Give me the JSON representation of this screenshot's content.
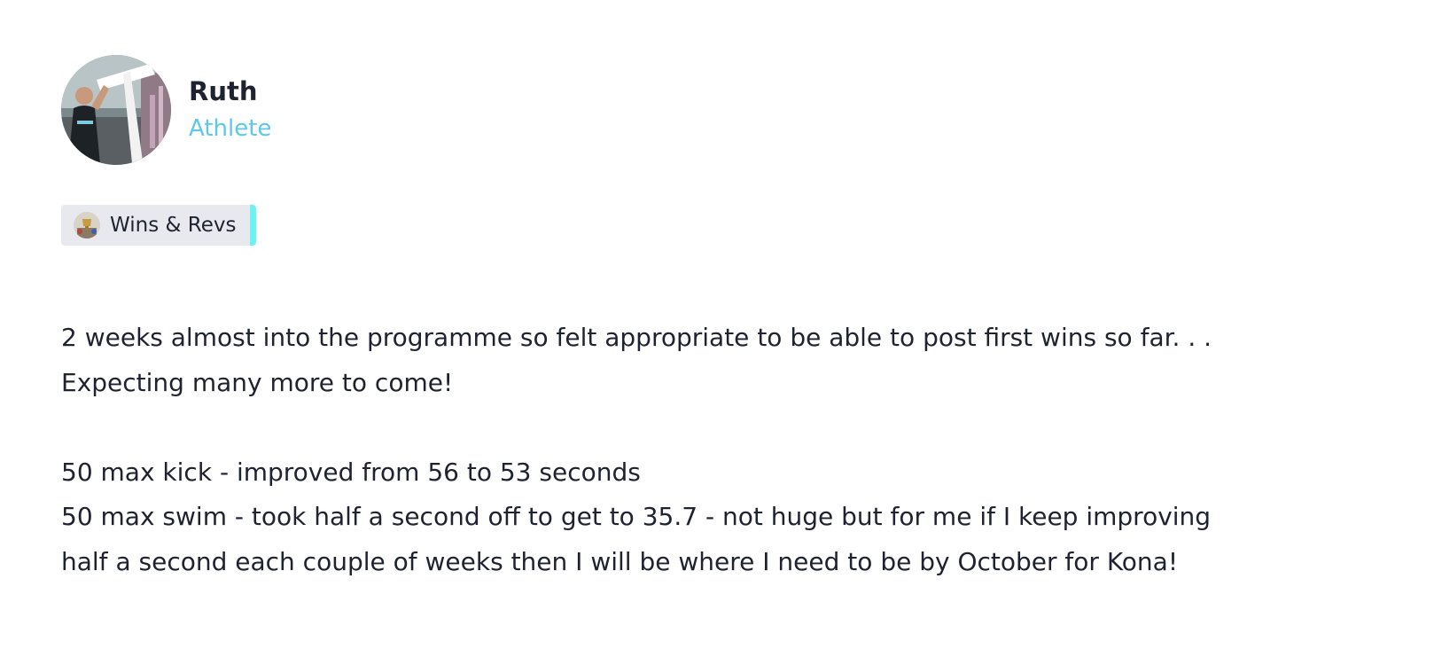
{
  "author": {
    "name": "Ruth",
    "role": "Athlete",
    "avatar_icon": "athlete-photo"
  },
  "tag": {
    "label": "Wins & Revs",
    "icon": "trophy-icon",
    "accent_color": "#6ef3f3"
  },
  "colors": {
    "role": "#5ec8e8",
    "text": "#1f2330",
    "tag_background": "#e8e9ee"
  },
  "body": {
    "paragraph1_line1": "2 weeks almost into the programme so felt appropriate to be able to post first wins so far. . .",
    "paragraph1_line2": "Expecting many more to come!",
    "line_kick": "50 max kick - improved from 56 to 53 seconds",
    "line_swim_1": "50 max swim - took half a second off to get to 35.7 - not huge but for me if I keep improving",
    "line_swim_2": "half a second each couple of weeks then I will be where I need to be by October for Kona!"
  }
}
